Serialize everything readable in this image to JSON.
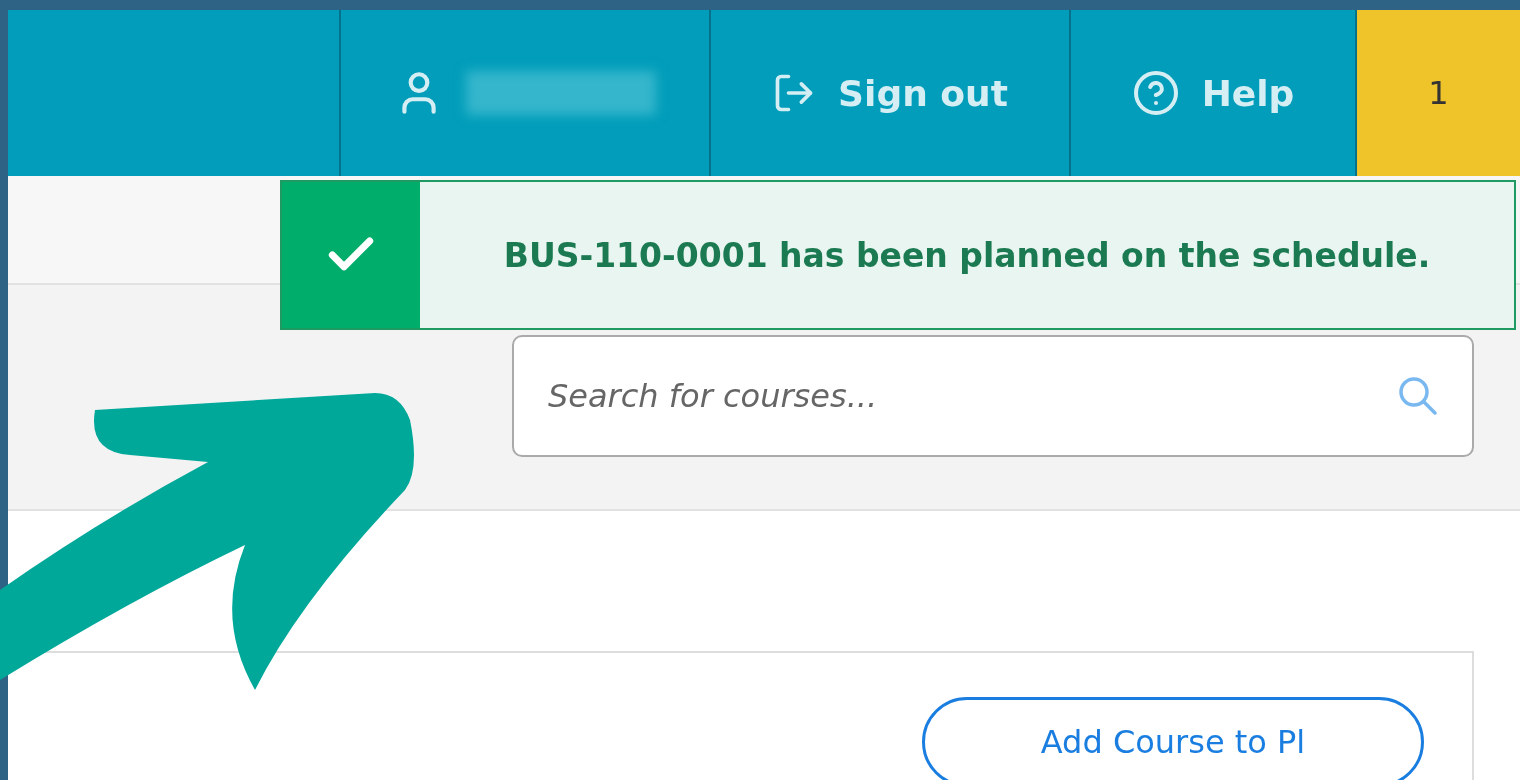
{
  "header": {
    "items": [
      {
        "kind": "signout",
        "label": "Sign out"
      },
      {
        "kind": "help",
        "label": "Help"
      }
    ],
    "badge": "1"
  },
  "toast": {
    "kind": "success",
    "message": "BUS-110-0001 has been planned on the schedule."
  },
  "search": {
    "placeholder": "Search for courses..."
  },
  "card": {
    "button": "Add Course to Pl"
  }
}
